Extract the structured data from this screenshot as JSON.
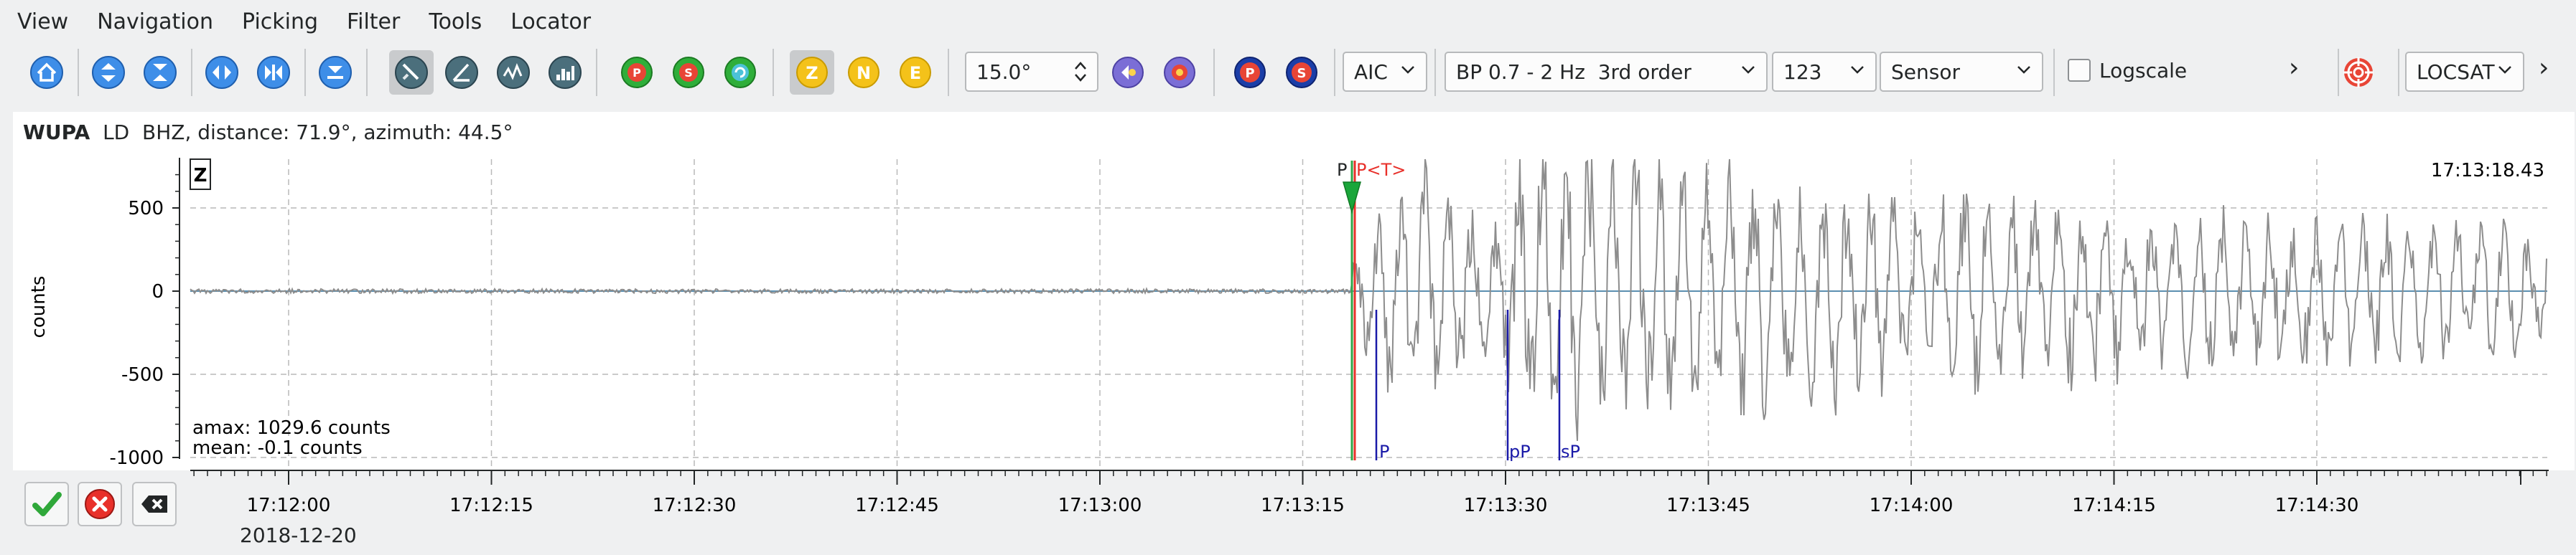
{
  "menu": [
    "View",
    "Navigation",
    "Picking",
    "Filter",
    "Tools",
    "Locator"
  ],
  "toolbar": {
    "phase_buttons": [
      "Z",
      "N",
      "E"
    ],
    "pick_buttons": [
      "P",
      "S"
    ],
    "rotation_value": "15.0°",
    "picker_method": "AIC",
    "filter": "BP 0.7 - 2 Hz  3rd order",
    "channel_number": "123",
    "sensor": "Sensor",
    "logscale_label": "Logscale",
    "logscale_checked": false,
    "more_glyph": "›",
    "locator": "LOCSAT",
    "more_glyph_2": "›"
  },
  "trace": {
    "station": "WUPA",
    "channel": "LD  BHZ, distance: 71.9°, azimuth: 44.5°",
    "component": "Z",
    "end_time": "17:13:18.43",
    "ylabel": "counts",
    "amax": "amax: 1029.6 counts",
    "mean": "mean: -0.1 counts",
    "y_ticks": [
      "500",
      "0",
      "-500",
      "-1000"
    ],
    "x_ticks": [
      "17:12:00",
      "17:12:15",
      "17:12:30",
      "17:12:45",
      "17:13:00",
      "17:13:15",
      "17:13:30",
      "17:13:45",
      "17:14:00",
      "17:14:15",
      "17:14:30"
    ],
    "date": "2018-12-20",
    "pick_labels": {
      "p": "P",
      "pt": "P<T>"
    },
    "theoretical_labels": [
      "P",
      "pP",
      "sP"
    ]
  }
}
